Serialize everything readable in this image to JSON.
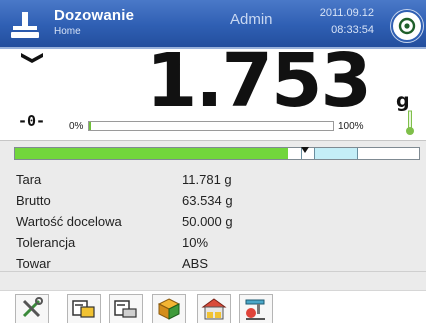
{
  "header": {
    "title": "Dozowanie",
    "subtitle": "Home",
    "user": "Admin",
    "date": "2011.09.12",
    "time": "08:33:54",
    "logo_icon": "scale-logo-icon",
    "power_icon": "power-icon"
  },
  "display": {
    "weight": "1.753",
    "unit": "g",
    "zero_indicator": "-0-",
    "bar_min": "0%",
    "bar_max": "100%",
    "load_fraction": 0.01,
    "stable_icon": "stability-marker-icon",
    "temperature_icon": "thermometer-icon"
  },
  "dosing": {
    "fill_fraction": 0.675,
    "target_fraction": 0.741,
    "tolerance_fraction": 0.1
  },
  "info": {
    "rows": [
      {
        "label": "Tara",
        "value": "11.781 g"
      },
      {
        "label": "Brutto",
        "value": "63.534 g"
      },
      {
        "label": "Wartość docelowa",
        "value": "50.000 g"
      },
      {
        "label": "Tolerancja",
        "value": "10%"
      },
      {
        "label": "Towar",
        "value": "ABS"
      }
    ]
  },
  "toolbar": {
    "buttons": [
      {
        "icon": "tools-icon"
      },
      {
        "icon": "tare-icon"
      },
      {
        "icon": "target-weight-icon"
      },
      {
        "icon": "product-box-icon"
      },
      {
        "icon": "warehouse-icon"
      },
      {
        "icon": "dispenser-icon"
      }
    ]
  },
  "colors": {
    "header_blue": "#2f5fb3",
    "progress_green": "#72d63c",
    "tolerance_cyan": "#c4eef7"
  }
}
